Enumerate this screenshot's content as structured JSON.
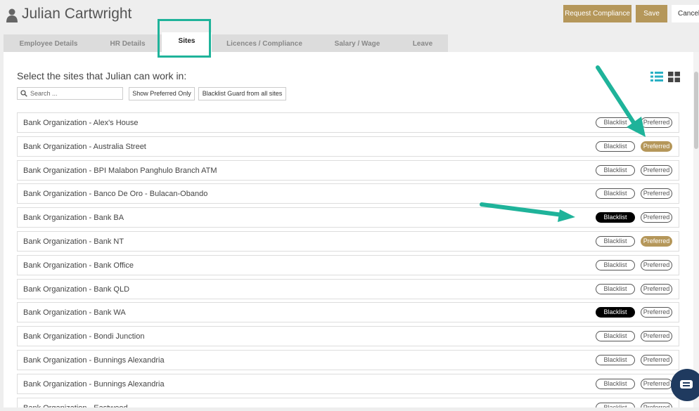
{
  "header": {
    "title": "Julian Cartwright",
    "request_compliance_label": "Request Compliance",
    "save_label": "Save",
    "cancel_label": "Cancel"
  },
  "tabs": [
    {
      "label": "Employee Details",
      "active": false
    },
    {
      "label": "HR Details",
      "active": false
    },
    {
      "label": "Sites",
      "active": true
    },
    {
      "label": "Licences / Compliance",
      "active": false
    },
    {
      "label": "Salary / Wage",
      "active": false
    },
    {
      "label": "Leave",
      "active": false
    }
  ],
  "sites_panel": {
    "instruction": "Select the sites that Julian can work in:",
    "search_placeholder": "Search ...",
    "search_value": "",
    "show_preferred_label": "Show Preferred Only",
    "blacklist_all_label": "Blacklist Guard from all sites",
    "blacklist_label": "Blacklist",
    "preferred_label": "Preferred"
  },
  "sites": [
    {
      "name": "Bank Organization - Alex's House",
      "blacklisted": false,
      "preferred": false
    },
    {
      "name": "Bank Organization - Australia Street",
      "blacklisted": false,
      "preferred": true
    },
    {
      "name": "Bank Organization - BPI Malabon Panghulo Branch ATM",
      "blacklisted": false,
      "preferred": false
    },
    {
      "name": "Bank Organization - Banco De Oro - Bulacan-Obando",
      "blacklisted": false,
      "preferred": false
    },
    {
      "name": "Bank Organization - Bank BA",
      "blacklisted": true,
      "preferred": false
    },
    {
      "name": "Bank Organization - Bank NT",
      "blacklisted": false,
      "preferred": true
    },
    {
      "name": "Bank Organization - Bank Office",
      "blacklisted": false,
      "preferred": false
    },
    {
      "name": "Bank Organization - Bank QLD",
      "blacklisted": false,
      "preferred": false
    },
    {
      "name": "Bank Organization - Bank WA",
      "blacklisted": true,
      "preferred": false
    },
    {
      "name": "Bank Organization - Bondi Junction",
      "blacklisted": false,
      "preferred": false
    },
    {
      "name": "Bank Organization - Bunnings Alexandria",
      "blacklisted": false,
      "preferred": false
    },
    {
      "name": "Bank Organization - Bunnings Alexandria",
      "blacklisted": false,
      "preferred": false
    },
    {
      "name": "Bank Organization - Eastwood",
      "blacklisted": false,
      "preferred": false
    }
  ],
  "colors": {
    "accent_gold": "#b5975a",
    "annotation_teal": "#1fb39a",
    "blacklist_on": "#000000",
    "chat_button": "#1f3a5f"
  },
  "icons": [
    "user-icon",
    "search-icon",
    "list-view-icon",
    "grid-view-icon",
    "chat-icon"
  ]
}
